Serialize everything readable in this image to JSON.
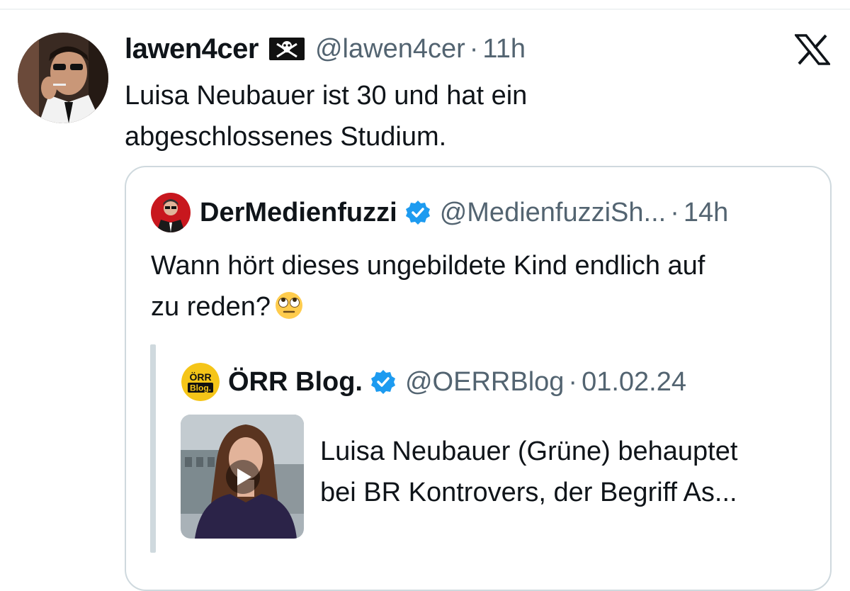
{
  "tweet": {
    "author_name": "lawen4cer",
    "handle": "@lawen4cer",
    "separator": "·",
    "time": "11h",
    "text_line1": "Luisa Neubauer ist 30 und hat ein",
    "text_line2": "abgeschlossenes Studium.",
    "flag_icon": "pirate-flag-icon",
    "platform_logo": "x-logo-icon"
  },
  "quoted": {
    "author_name": "DerMedienfuzzi",
    "handle": "@MedienfuzziSh...",
    "separator": "·",
    "time": "14h",
    "verified": true,
    "text_line1": "Wann hört dieses ungebildete Kind endlich auf",
    "text_line2": "zu reden?",
    "emoji": "eye-roll-emoji-icon"
  },
  "nested": {
    "author_name": "ÖRR Blog.",
    "handle": "@OERRBlog",
    "separator": "·",
    "time": "01.02.24",
    "verified": true,
    "avatar_text_top": "ÖRR",
    "avatar_text_bottom": "Blog.",
    "text_line1": "Luisa Neubauer (Grüne) behauptet",
    "text_line2": "bei BR Kontrovers, der Begriff As...",
    "media": "video-thumbnail"
  },
  "colors": {
    "text": "#0f1419",
    "secondary": "#536471",
    "border": "#cfd9de",
    "verified": "#1d9bf0"
  }
}
